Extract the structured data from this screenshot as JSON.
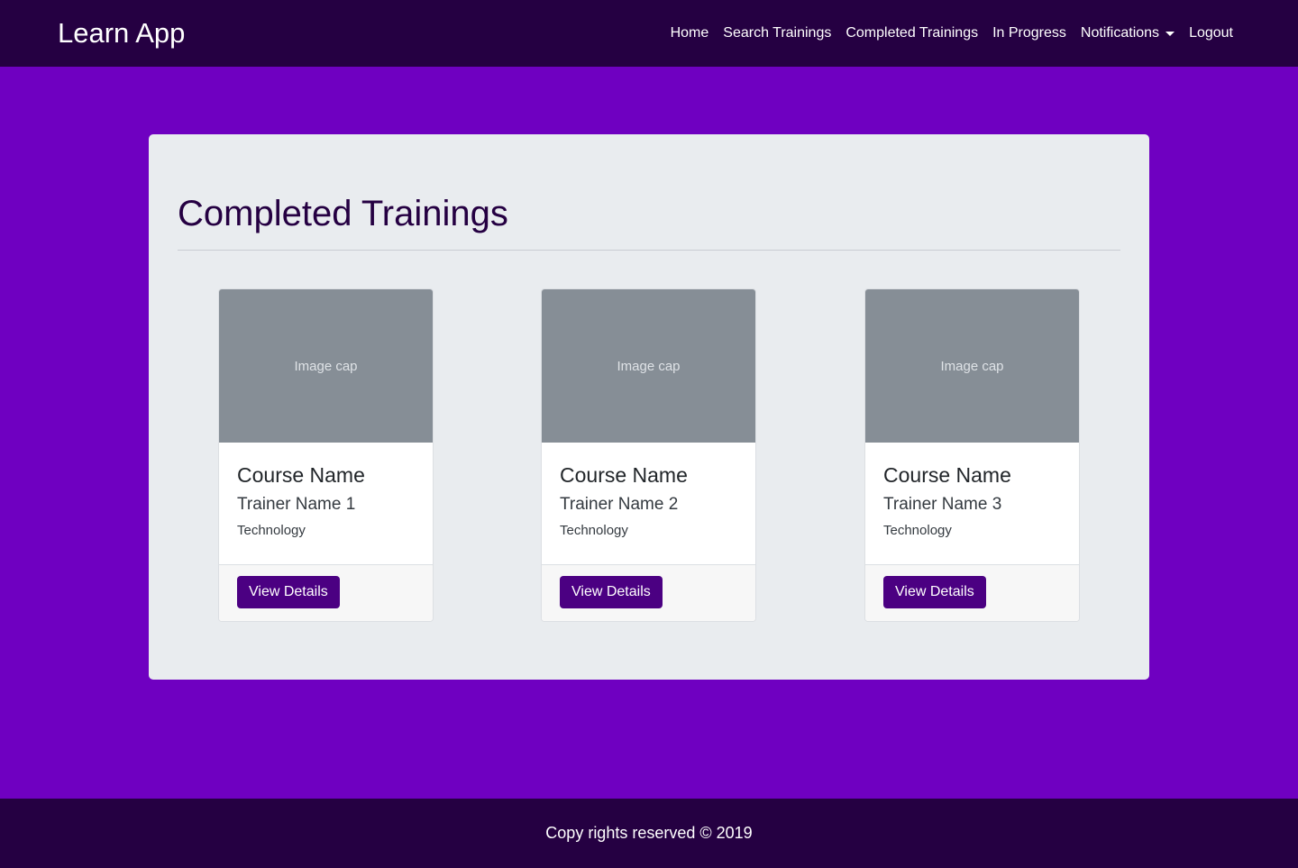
{
  "navbar": {
    "brand": "Learn App",
    "links": [
      {
        "label": "Home"
      },
      {
        "label": "Search Trainings"
      },
      {
        "label": "Completed Trainings"
      },
      {
        "label": "In Progress"
      },
      {
        "label": "Notifications"
      },
      {
        "label": "Logout"
      }
    ]
  },
  "main": {
    "title": "Completed Trainings",
    "cards": [
      {
        "image_text": "Image cap",
        "course": "Course Name",
        "trainer": "Trainer Name 1",
        "category": "Technology",
        "button": "View Details"
      },
      {
        "image_text": "Image cap",
        "course": "Course Name",
        "trainer": "Trainer Name 2",
        "category": "Technology",
        "button": "View Details"
      },
      {
        "image_text": "Image cap",
        "course": "Course Name",
        "trainer": "Trainer Name 3",
        "category": "Technology",
        "button": "View Details"
      }
    ]
  },
  "footer": {
    "text": "Copy rights reserved © 2019"
  },
  "colors": {
    "navbar_bg": "#250042",
    "page_bg": "#6f00c1",
    "panel_bg": "#e9ecef",
    "button_bg": "#4b0082",
    "image_placeholder": "#868e96"
  }
}
